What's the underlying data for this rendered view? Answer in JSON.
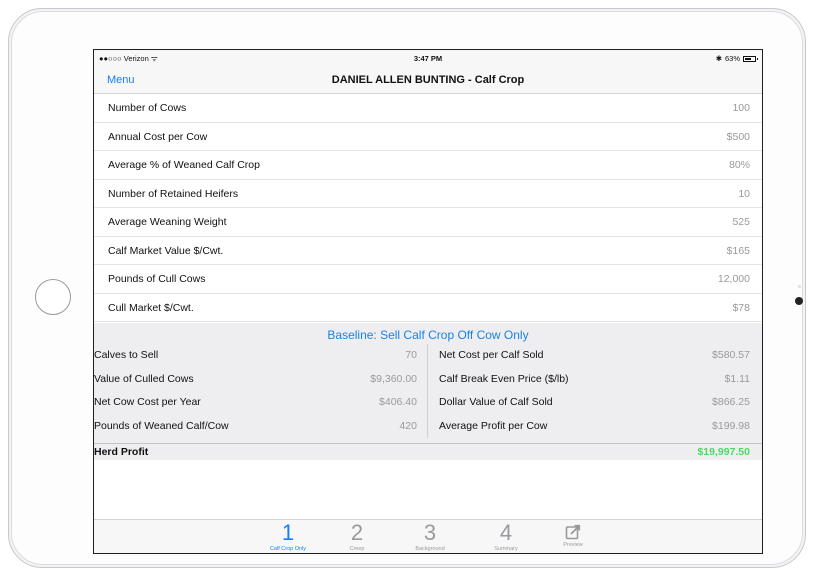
{
  "status": {
    "carrier": "●●○○○ Verizon ᯤ",
    "time": "3:47 PM",
    "battery": "63%",
    "battery_level": 0.63
  },
  "nav": {
    "menu": "Menu",
    "title": "DANIEL ALLEN BUNTING - Calf Crop"
  },
  "inputs": [
    {
      "label": "Number of Cows",
      "value": "100"
    },
    {
      "label": "Annual Cost per Cow",
      "value": "$500"
    },
    {
      "label": "Average % of Weaned Calf Crop",
      "value": "80%"
    },
    {
      "label": "Number of Retained Heifers",
      "value": "10"
    },
    {
      "label": "Average Weaning Weight",
      "value": "525"
    },
    {
      "label": "Calf Market Value $/Cwt.",
      "value": "$165"
    },
    {
      "label": "Pounds of Cull Cows",
      "value": "12,000"
    },
    {
      "label": "Cull Market $/Cwt.",
      "value": "$78"
    }
  ],
  "baseline": {
    "title": "Baseline: Sell Calf Crop Off Cow Only",
    "left": [
      {
        "label": "Calves to Sell",
        "value": "70"
      },
      {
        "label": "Value of Culled Cows",
        "value": "$9,360.00"
      },
      {
        "label": "Net Cow Cost per Year",
        "value": "$406.40"
      },
      {
        "label": "Pounds of Weaned Calf/Cow",
        "value": "420"
      }
    ],
    "right": [
      {
        "label": "Net Cost per Calf Sold",
        "value": "$580.57"
      },
      {
        "label": "Calf Break Even Price ($/lb)",
        "value": "$1.11"
      },
      {
        "label": "Dollar Value of Calf Sold",
        "value": "$866.25"
      },
      {
        "label": "Average Profit per Cow",
        "value": "$199.98"
      }
    ],
    "herd_profit_label": "Herd Profit",
    "herd_profit_value": "$19,997.50"
  },
  "tabs": [
    {
      "num": "1",
      "label": "Calf Crop Only",
      "active": true
    },
    {
      "num": "2",
      "label": "Creep"
    },
    {
      "num": "3",
      "label": "Background"
    },
    {
      "num": "4",
      "label": "Summary"
    },
    {
      "icon": "share-icon",
      "label": "Preview"
    }
  ],
  "colors": {
    "accent": "#157efb",
    "profit": "#4cd964",
    "section_title": "#1a82e6"
  }
}
